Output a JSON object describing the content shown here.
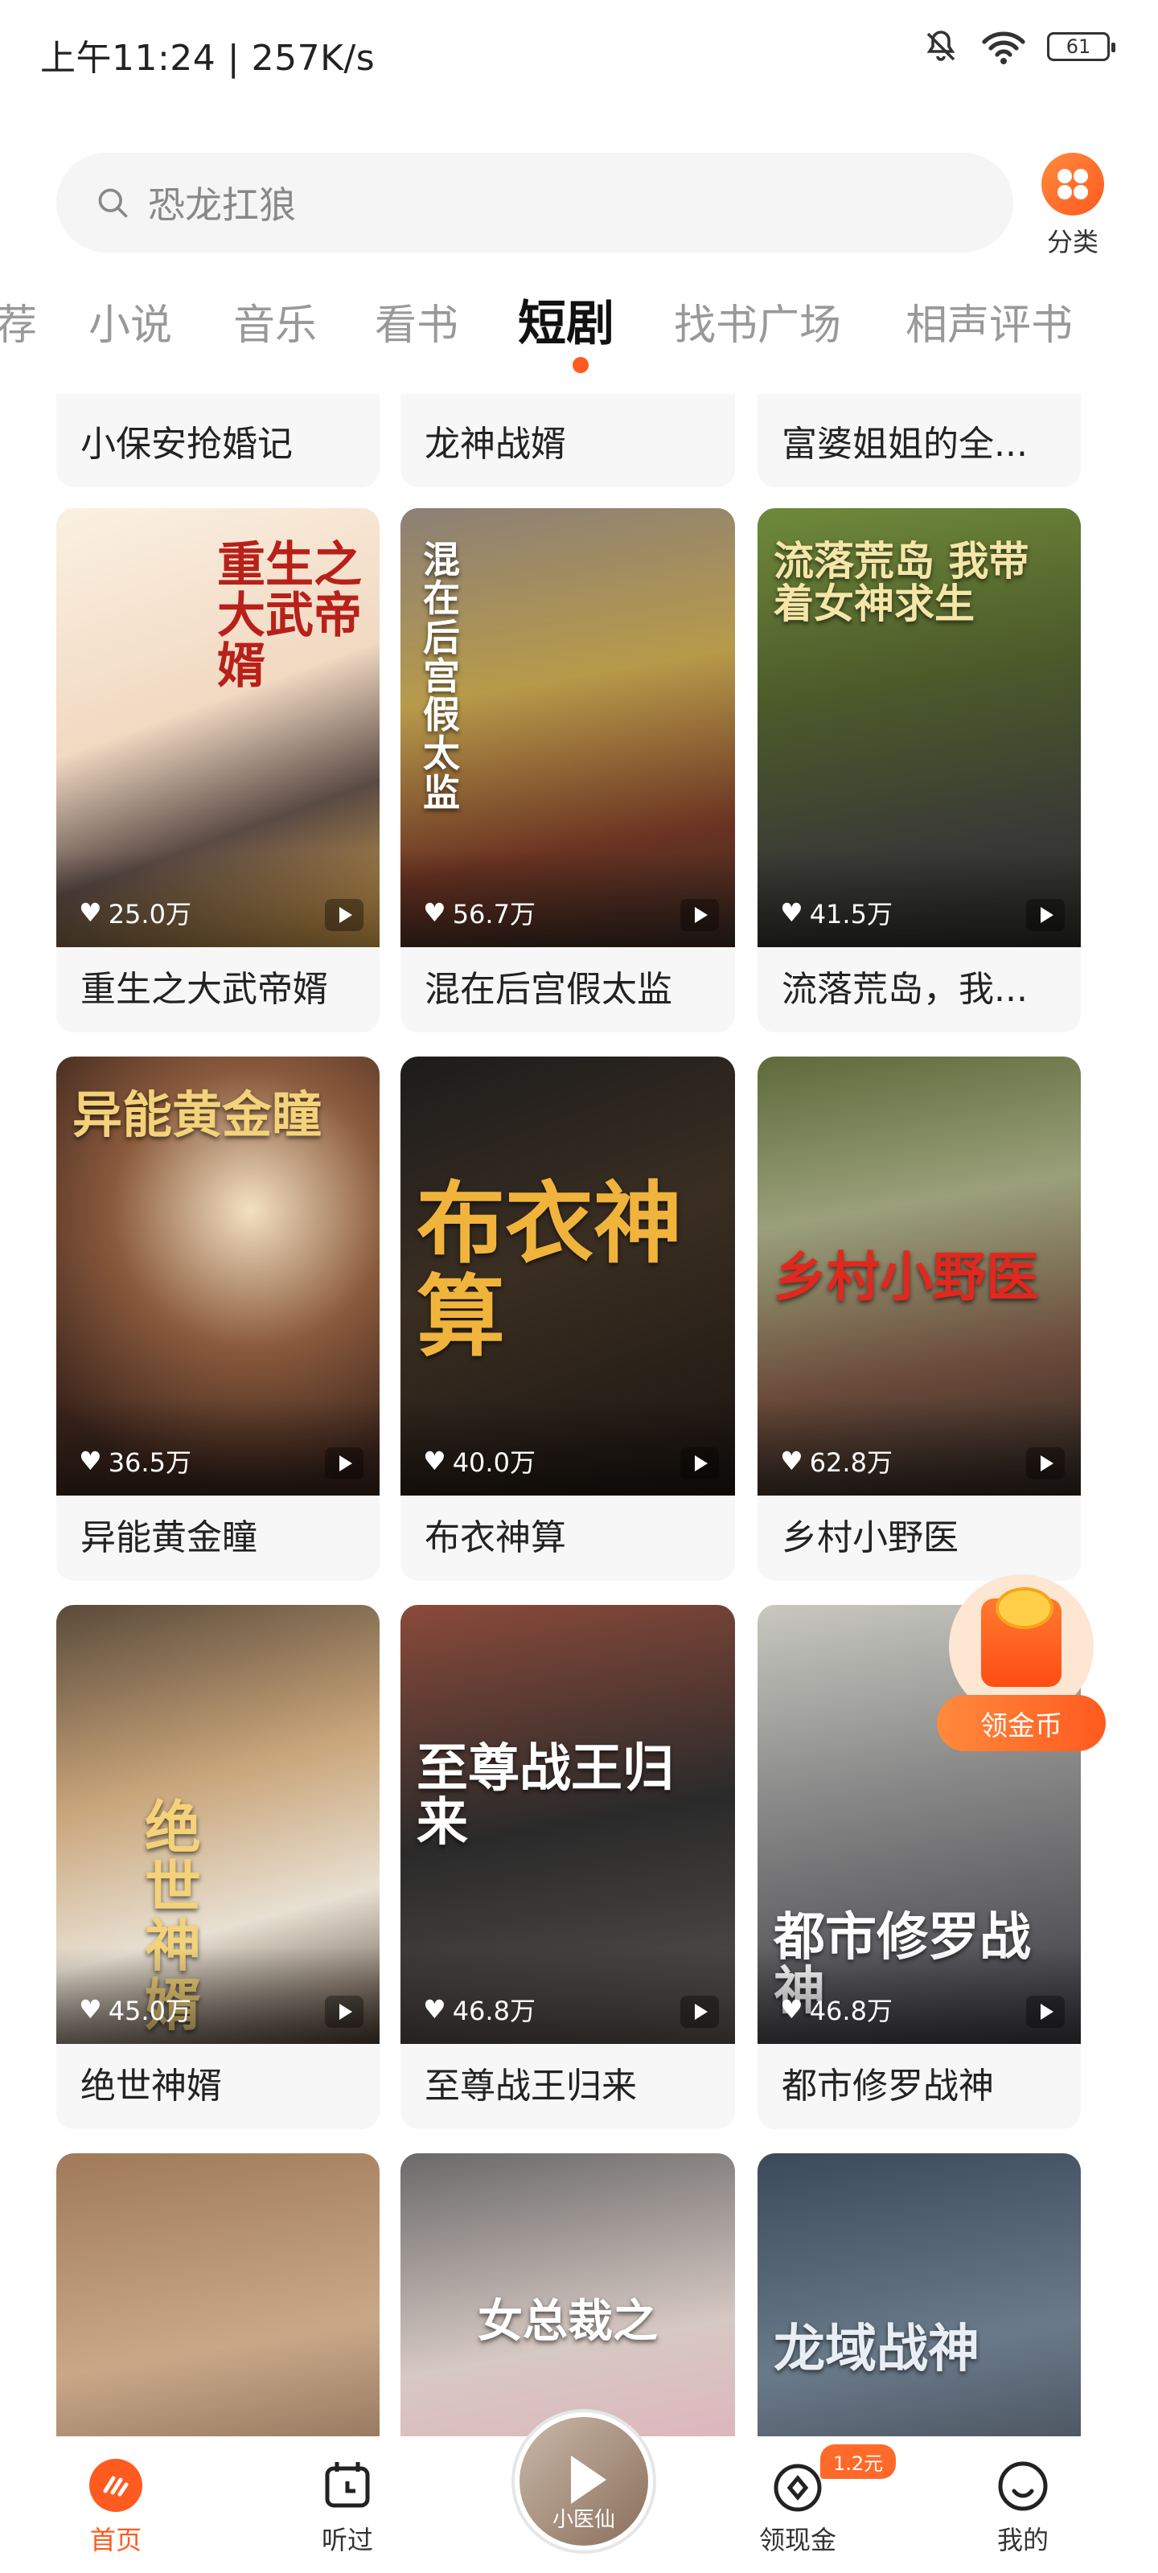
{
  "status_bar": {
    "time": "上午11:24 | 257K/s",
    "battery": "61"
  },
  "search": {
    "placeholder": "恐龙扛狼"
  },
  "category": {
    "label": "分类"
  },
  "tabs": [
    {
      "label": "荐"
    },
    {
      "label": "小说"
    },
    {
      "label": "音乐"
    },
    {
      "label": "看书"
    },
    {
      "label": "短剧",
      "active": true
    },
    {
      "label": "找书广场"
    },
    {
      "label": "相声评书"
    }
  ],
  "cards": [
    {
      "title": "小保安抢婚记"
    },
    {
      "title": "龙神战婿"
    },
    {
      "title": "富婆姐姐的全..."
    },
    {
      "title": "重生之大武帝婿",
      "likes": "25.0万",
      "poster_text": "重生之大武帝婿"
    },
    {
      "title": "混在后宫假太监",
      "likes": "56.7万",
      "poster_text": "混在后宫假太监"
    },
    {
      "title": "流落荒岛，我...",
      "likes": "41.5万",
      "poster_text": "流落荒岛 我带着女神求生"
    },
    {
      "title": "异能黄金瞳",
      "likes": "36.5万",
      "poster_text": "异能黄金瞳"
    },
    {
      "title": "布衣神算",
      "likes": "40.0万",
      "poster_text": "布衣神算"
    },
    {
      "title": "乡村小野医",
      "likes": "62.8万",
      "poster_text": "乡村小野医"
    },
    {
      "title": "绝世神婿",
      "likes": "45.0万",
      "poster_text": "绝世神婿"
    },
    {
      "title": "至尊战王归来",
      "likes": "46.8万",
      "poster_text": "至尊战王归来"
    },
    {
      "title": "都市修罗战神",
      "likes": "46.8万",
      "poster_text": "都市修罗战神"
    },
    {
      "title": "",
      "poster_text": ""
    },
    {
      "title": "",
      "poster_text": "女总裁之"
    },
    {
      "title": "",
      "poster_text": "龙域战神"
    }
  ],
  "floating_reward": {
    "label": "领金币"
  },
  "bottom_nav": {
    "home": "首页",
    "history": "听过",
    "center_disc_text": "小医仙",
    "cash": "领现金",
    "cash_badge": "1.2元",
    "mine": "我的"
  },
  "colors": {
    "accent": "#ff5a1f",
    "bg": "#ffffff"
  }
}
